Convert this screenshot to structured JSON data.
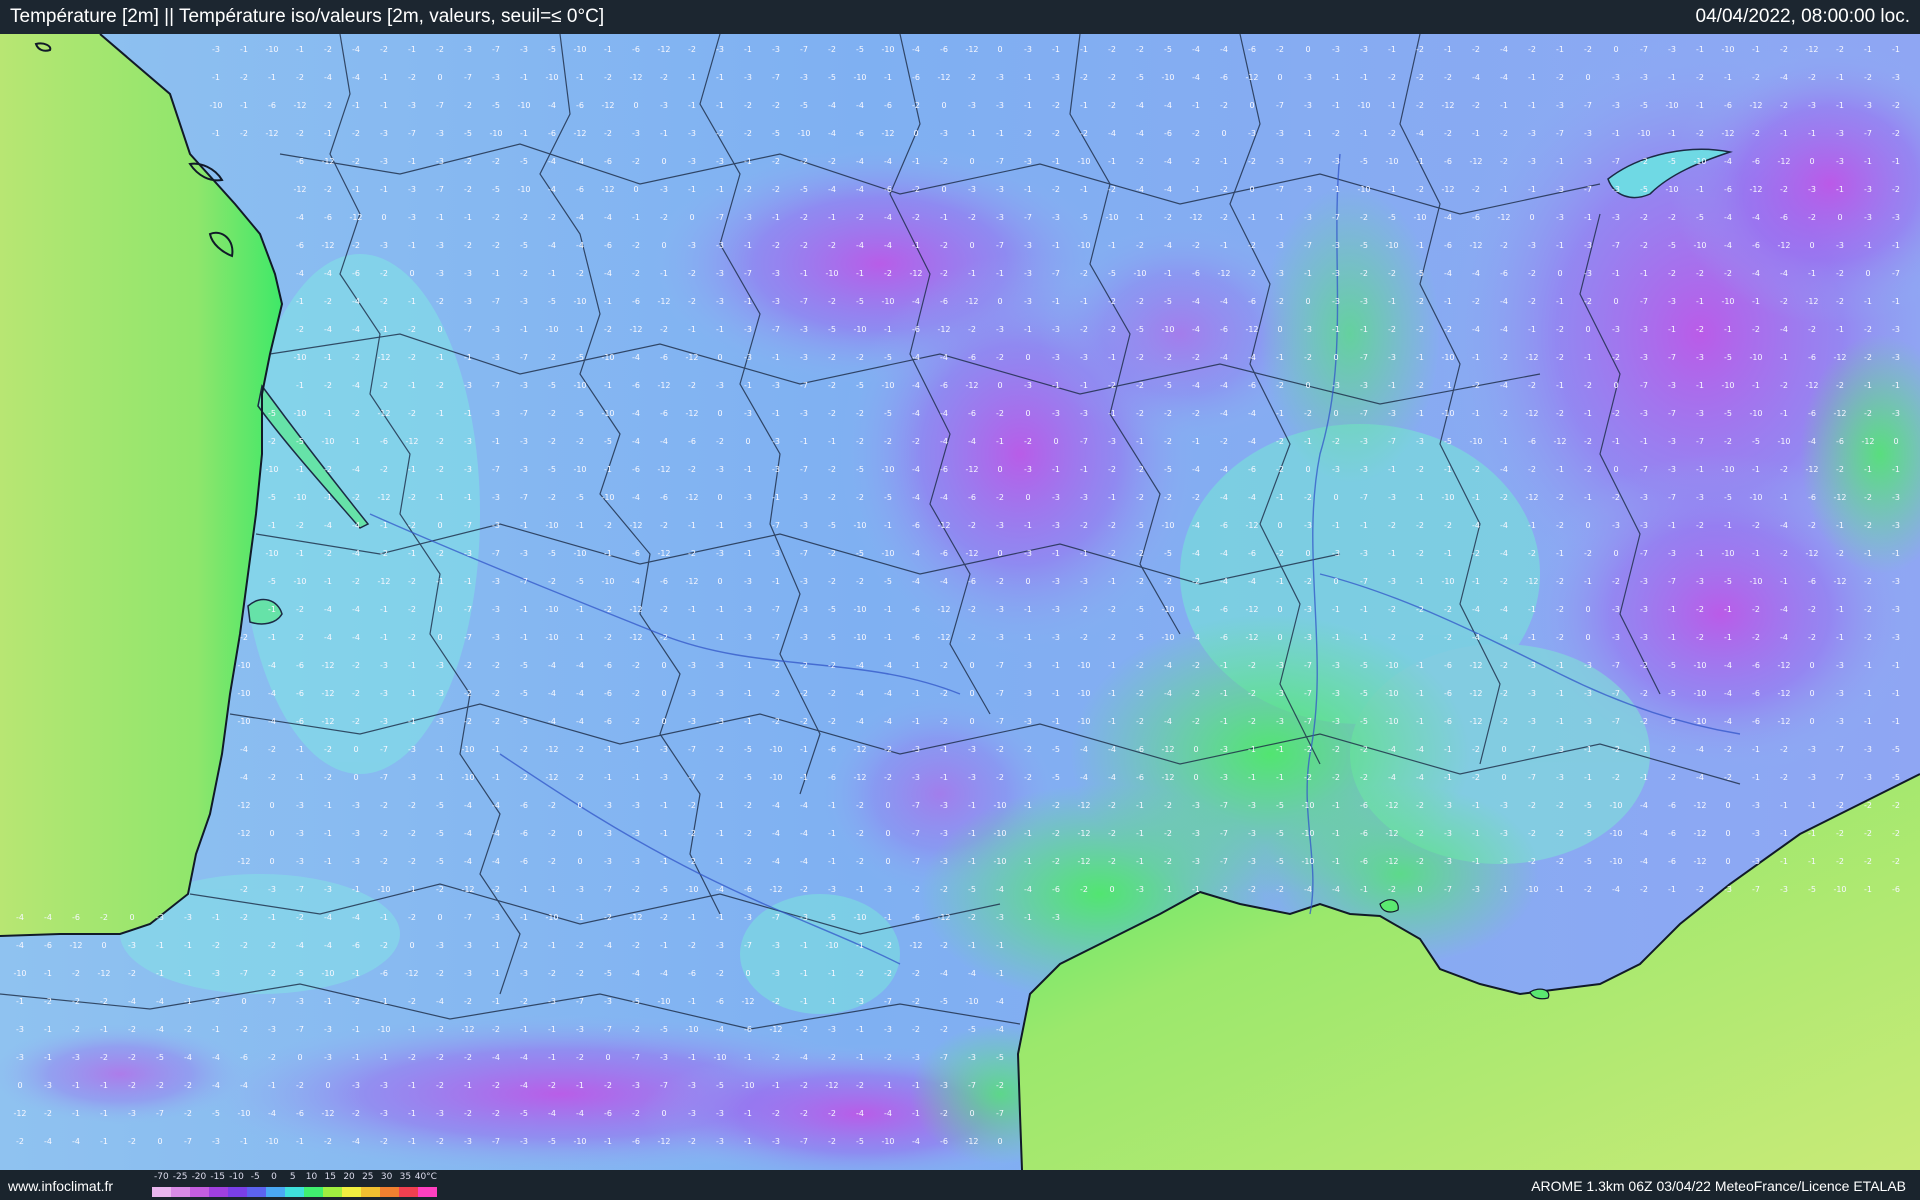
{
  "header": {
    "title": "Température [2m] || Température iso/valeurs [2m, valeurs, seuil=≤ 0°C]",
    "datetime": "04/04/2022, 08:00:00 loc."
  },
  "footer": {
    "site": "www.infoclimat.fr",
    "credit": "AROME 1.3km 06Z 03/04/22 MeteoFrance/Licence ETALAB",
    "legend_ticks": [
      "-70",
      "-25",
      "-20",
      "-15",
      "-10",
      "-5",
      "0",
      "5",
      "10",
      "15",
      "20",
      "25",
      "30",
      "35",
      "40°C"
    ],
    "legend_colors": [
      "#e9b6ee",
      "#d98be6",
      "#c45ee0",
      "#a040e0",
      "#7a3fe8",
      "#5c63f0",
      "#4aa8f4",
      "#3fe0dc",
      "#40f070",
      "#a0f040",
      "#f0f040",
      "#f0c030",
      "#f08030",
      "#f04050",
      "#ff40c0"
    ]
  },
  "colors": {
    "sea": "#b9e873",
    "sea_coast": "#58e860",
    "land_warm": "#5be870",
    "land_cold": "#6fe9d9",
    "frost_light": "#8fb4f3",
    "frost_strong": "#c563ea",
    "borders": "#1b2a44",
    "rivers": "#3256c8"
  },
  "map": {
    "grid_step_x": 14,
    "grid_step_y": 14,
    "label_values": [
      "-2",
      "-1",
      "-3",
      "-2",
      "-1",
      "-4",
      "-2",
      "0",
      "-3",
      "-1",
      "-5",
      "-2",
      "-6",
      "-1",
      "-3",
      "-7",
      "-2",
      "-10",
      "-4",
      "-12"
    ]
  }
}
